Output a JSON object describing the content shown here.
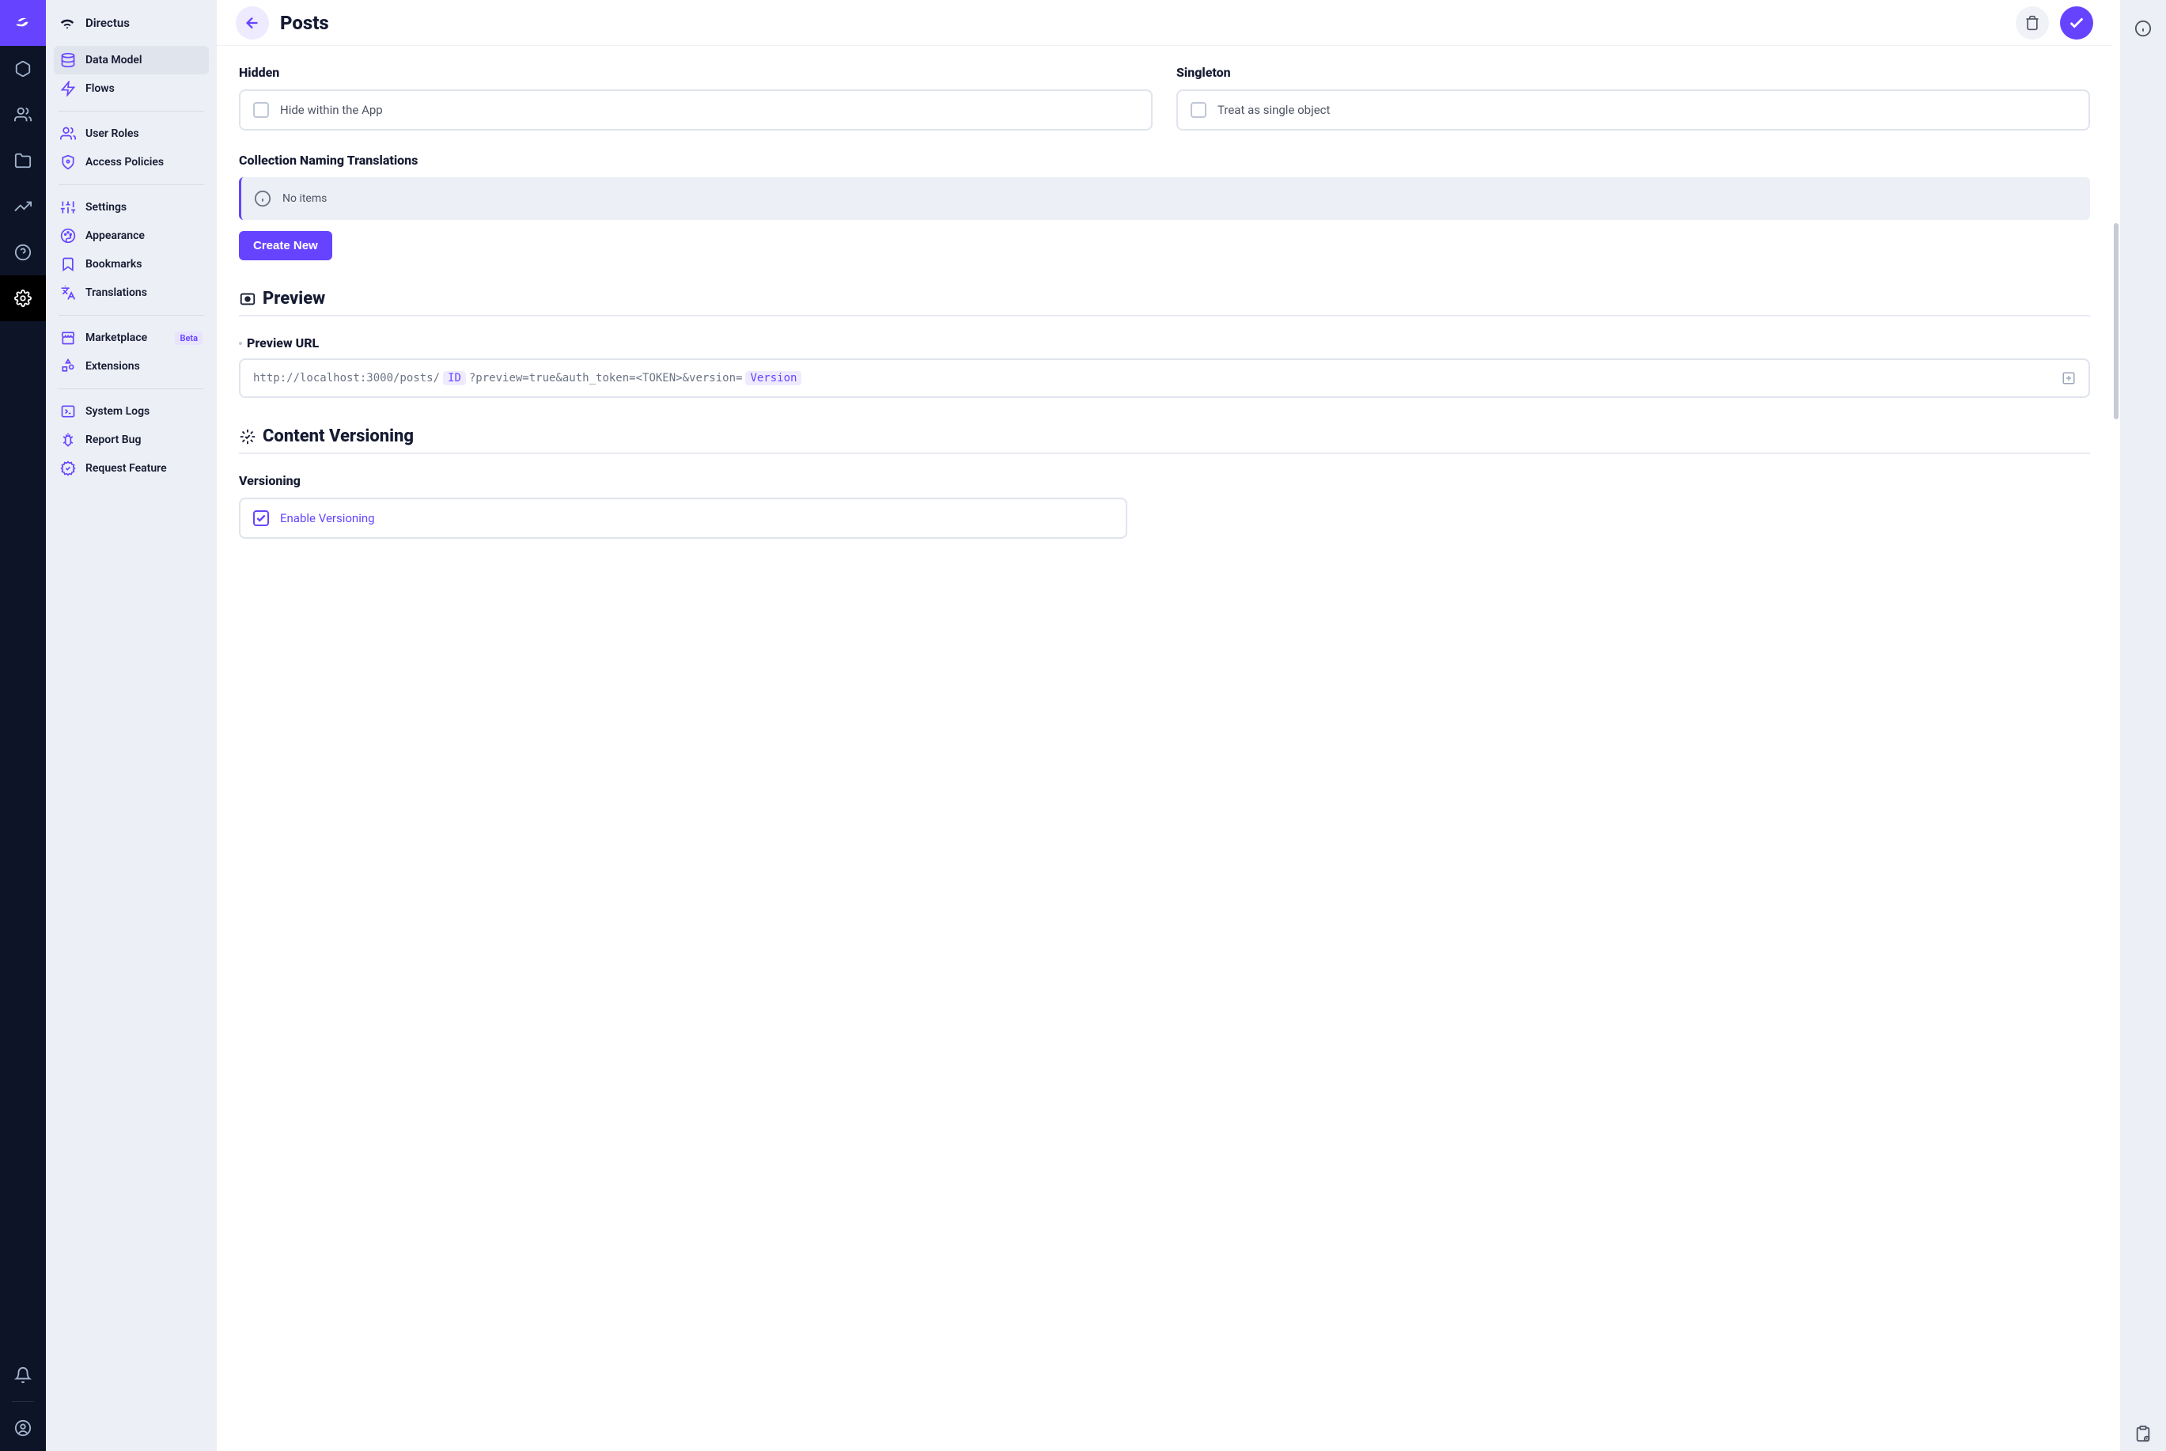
{
  "app": {
    "name": "Directus"
  },
  "sidebar": {
    "groups": [
      {
        "items": [
          {
            "label": "Data Model",
            "active": true
          },
          {
            "label": "Flows"
          }
        ]
      },
      {
        "items": [
          {
            "label": "User Roles"
          },
          {
            "label": "Access Policies"
          }
        ]
      },
      {
        "items": [
          {
            "label": "Settings"
          },
          {
            "label": "Appearance"
          },
          {
            "label": "Bookmarks"
          },
          {
            "label": "Translations"
          }
        ]
      },
      {
        "items": [
          {
            "label": "Marketplace",
            "badge": "Beta"
          },
          {
            "label": "Extensions"
          }
        ]
      },
      {
        "items": [
          {
            "label": "System Logs"
          },
          {
            "label": "Report Bug"
          },
          {
            "label": "Request Feature"
          }
        ]
      }
    ]
  },
  "page": {
    "title": "Posts",
    "hidden": {
      "label": "Hidden",
      "checkbox": "Hide within the App",
      "checked": false
    },
    "singleton": {
      "label": "Singleton",
      "checkbox": "Treat as single object",
      "checked": false
    },
    "translations": {
      "label": "Collection Naming Translations",
      "empty": "No items",
      "create": "Create New"
    },
    "preview": {
      "heading": "Preview",
      "url_label": "Preview URL",
      "url_parts": {
        "p1": "http://localhost:3000/posts/",
        "chip1": "ID",
        "p2": "?preview=true&auth_token=<TOKEN>&version=",
        "chip2": "Version"
      }
    },
    "versioning": {
      "heading": "Content Versioning",
      "label": "Versioning",
      "checkbox": "Enable Versioning",
      "checked": true
    }
  }
}
